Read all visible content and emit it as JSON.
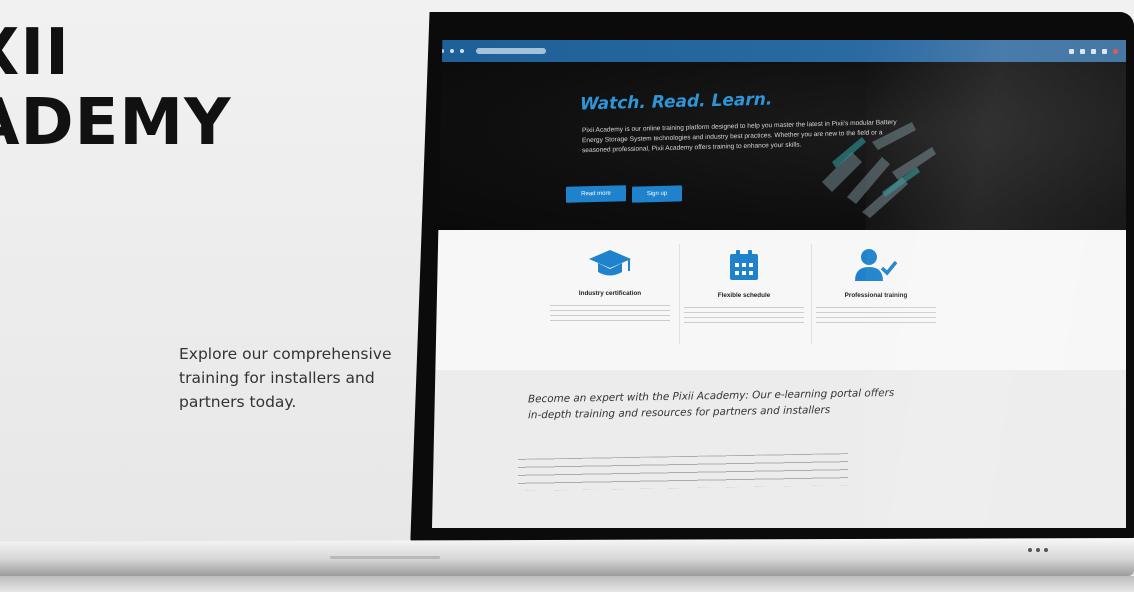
{
  "hero": {
    "title_line1": "XII",
    "title_line2": "ADEMY",
    "subtitle": "Explore our comprehensive training for installers and partners today."
  },
  "site": {
    "hero_title": "Watch. Read. Learn.",
    "hero_text": "Pixii Academy is our online training platform designed to help you master the latest in Pixii's modular Battery Energy Storage System technologies and industry best practices. Whether you are new to the field or a seasoned professional, Pixii Academy offers training to enhance your skills.",
    "read_more_label": "Read more",
    "sign_up_label": "Sign up",
    "features": [
      {
        "title": "Industry certification"
      },
      {
        "title": "Flexible schedule"
      },
      {
        "title": "Professional training"
      }
    ],
    "about_heading": "Become an expert with the Pixii Academy: Our e-learning portal offers in-depth training and resources for partners and installers"
  },
  "colors": {
    "accent": "#1f82cc",
    "hero_title": "#2e95d8",
    "dark_bg": "#0f0f0f"
  }
}
